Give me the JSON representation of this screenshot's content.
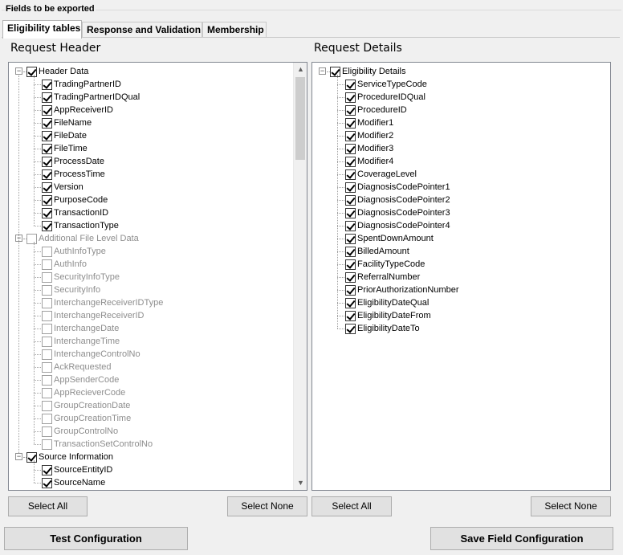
{
  "group_title": "Fields to be exported",
  "tabs": [
    {
      "label": "Eligibility tables"
    },
    {
      "label": "Response and Validation"
    },
    {
      "label": "Membership"
    }
  ],
  "left": {
    "title": "Request Header",
    "select_all": "Select All",
    "select_none": "Select None",
    "nodes": [
      {
        "label": "Header Data",
        "level": 0,
        "checked": true,
        "disabled": false,
        "expander": "-"
      },
      {
        "label": "TradingPartnerID",
        "level": 1,
        "checked": true,
        "disabled": false
      },
      {
        "label": "TradingPartnerIDQual",
        "level": 1,
        "checked": true,
        "disabled": false
      },
      {
        "label": "AppReceiverID",
        "level": 1,
        "checked": true,
        "disabled": false
      },
      {
        "label": "FileName",
        "level": 1,
        "checked": true,
        "disabled": false
      },
      {
        "label": "FileDate",
        "level": 1,
        "checked": true,
        "disabled": false
      },
      {
        "label": "FileTime",
        "level": 1,
        "checked": true,
        "disabled": false
      },
      {
        "label": "ProcessDate",
        "level": 1,
        "checked": true,
        "disabled": false
      },
      {
        "label": "ProcessTime",
        "level": 1,
        "checked": true,
        "disabled": false
      },
      {
        "label": "Version",
        "level": 1,
        "checked": true,
        "disabled": false
      },
      {
        "label": "PurposeCode",
        "level": 1,
        "checked": true,
        "disabled": false
      },
      {
        "label": "TransactionID",
        "level": 1,
        "checked": true,
        "disabled": false
      },
      {
        "label": "TransactionType",
        "level": 1,
        "checked": true,
        "disabled": false
      },
      {
        "label": "Additional File Level Data",
        "level": 0,
        "checked": false,
        "disabled": true,
        "expander": "-"
      },
      {
        "label": "AuthInfoType",
        "level": 1,
        "checked": false,
        "disabled": true
      },
      {
        "label": "AuthInfo",
        "level": 1,
        "checked": false,
        "disabled": true
      },
      {
        "label": "SecurityInfoType",
        "level": 1,
        "checked": false,
        "disabled": true
      },
      {
        "label": "SecurityInfo",
        "level": 1,
        "checked": false,
        "disabled": true
      },
      {
        "label": "InterchangeReceiverIDType",
        "level": 1,
        "checked": false,
        "disabled": true
      },
      {
        "label": "InterchangeReceiverID",
        "level": 1,
        "checked": false,
        "disabled": true
      },
      {
        "label": "InterchangeDate",
        "level": 1,
        "checked": false,
        "disabled": true
      },
      {
        "label": "InterchangeTime",
        "level": 1,
        "checked": false,
        "disabled": true
      },
      {
        "label": "InterchangeControlNo",
        "level": 1,
        "checked": false,
        "disabled": true
      },
      {
        "label": "AckRequested",
        "level": 1,
        "checked": false,
        "disabled": true
      },
      {
        "label": "AppSenderCode",
        "level": 1,
        "checked": false,
        "disabled": true
      },
      {
        "label": "AppRecieverCode",
        "level": 1,
        "checked": false,
        "disabled": true
      },
      {
        "label": "GroupCreationDate",
        "level": 1,
        "checked": false,
        "disabled": true
      },
      {
        "label": "GroupCreationTime",
        "level": 1,
        "checked": false,
        "disabled": true
      },
      {
        "label": "GroupControlNo",
        "level": 1,
        "checked": false,
        "disabled": true
      },
      {
        "label": "TransactionSetControlNo",
        "level": 1,
        "checked": false,
        "disabled": true
      },
      {
        "label": "Source Information",
        "level": 0,
        "checked": true,
        "disabled": false,
        "expander": "-"
      },
      {
        "label": "SourceEntityID",
        "level": 1,
        "checked": true,
        "disabled": false
      },
      {
        "label": "SourceName",
        "level": 1,
        "checked": true,
        "disabled": false
      }
    ]
  },
  "right": {
    "title": "Request Details",
    "select_all": "Select All",
    "select_none": "Select None",
    "nodes": [
      {
        "label": "Eligibility Details",
        "level": 0,
        "checked": true,
        "disabled": false,
        "expander": "-"
      },
      {
        "label": "ServiceTypeCode",
        "level": 1,
        "checked": true,
        "disabled": false
      },
      {
        "label": "ProcedureIDQual",
        "level": 1,
        "checked": true,
        "disabled": false
      },
      {
        "label": "ProcedureID",
        "level": 1,
        "checked": true,
        "disabled": false
      },
      {
        "label": "Modifier1",
        "level": 1,
        "checked": true,
        "disabled": false
      },
      {
        "label": "Modifier2",
        "level": 1,
        "checked": true,
        "disabled": false
      },
      {
        "label": "Modifier3",
        "level": 1,
        "checked": true,
        "disabled": false
      },
      {
        "label": "Modifier4",
        "level": 1,
        "checked": true,
        "disabled": false
      },
      {
        "label": "CoverageLevel",
        "level": 1,
        "checked": true,
        "disabled": false
      },
      {
        "label": "DiagnosisCodePointer1",
        "level": 1,
        "checked": true,
        "disabled": false
      },
      {
        "label": "DiagnosisCodePointer2",
        "level": 1,
        "checked": true,
        "disabled": false
      },
      {
        "label": "DiagnosisCodePointer3",
        "level": 1,
        "checked": true,
        "disabled": false
      },
      {
        "label": "DiagnosisCodePointer4",
        "level": 1,
        "checked": true,
        "disabled": false
      },
      {
        "label": "SpentDownAmount",
        "level": 1,
        "checked": true,
        "disabled": false
      },
      {
        "label": "BilledAmount",
        "level": 1,
        "checked": true,
        "disabled": false
      },
      {
        "label": "FacilityTypeCode",
        "level": 1,
        "checked": true,
        "disabled": false
      },
      {
        "label": "ReferralNumber",
        "level": 1,
        "checked": true,
        "disabled": false
      },
      {
        "label": "PriorAuthorizationNumber",
        "level": 1,
        "checked": true,
        "disabled": false
      },
      {
        "label": "EligibilityDateQual",
        "level": 1,
        "checked": true,
        "disabled": false
      },
      {
        "label": "EligibilityDateFrom",
        "level": 1,
        "checked": true,
        "disabled": false
      },
      {
        "label": "EligibilityDateTo",
        "level": 1,
        "checked": true,
        "disabled": false
      }
    ]
  },
  "footer": {
    "test_label": "Test Configuration",
    "save_label": "Save Field Configuration"
  },
  "colors": {
    "panel_bg": "#f0f0f0",
    "tree_bg": "#ffffff",
    "disabled_text": "#8e8e8e",
    "button_bg": "#e1e1e1"
  }
}
